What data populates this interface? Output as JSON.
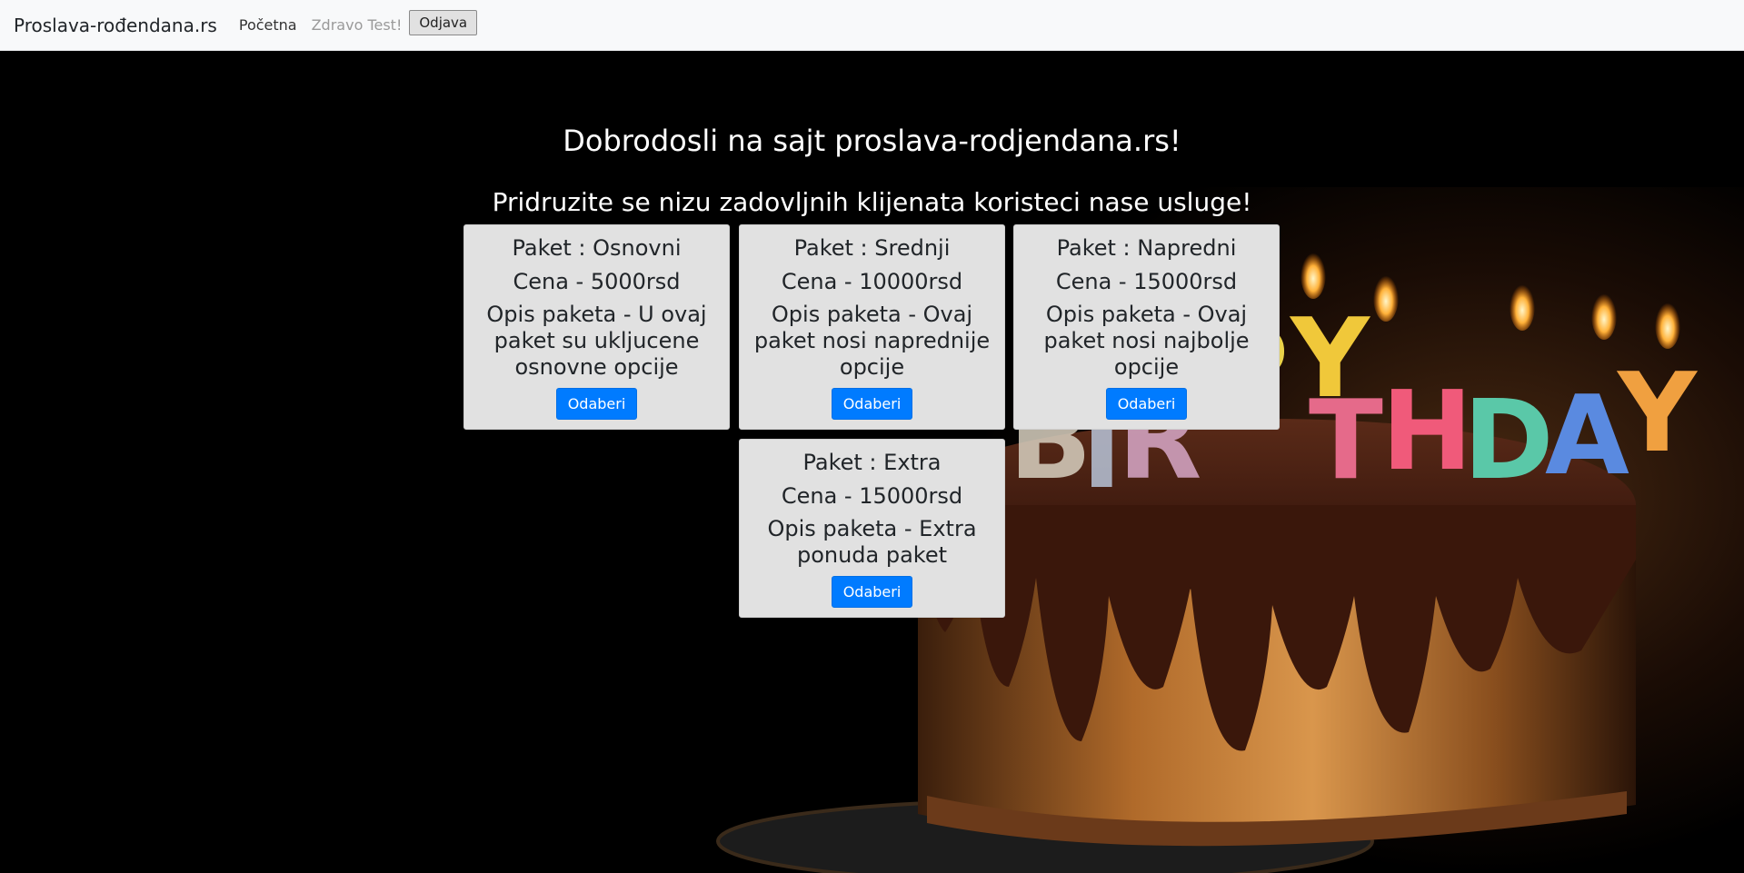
{
  "navbar": {
    "brand": "Proslava-rođendana.rs",
    "home_link": "Početna",
    "greeting": "Zdravo Test!",
    "logout_label": "Odjava"
  },
  "hero": {
    "welcome": "Dobrodosli na sajt proslava-rodjendana.rs!",
    "tagline": "Pridruzite se nizu zadovljnih klijenata koristeci nase usluge!",
    "background_image": "birthday-cake-with-candles",
    "cake_text": "BIRTHDAY"
  },
  "packages": [
    {
      "title": "Paket : Osnovni",
      "price": "Cena - 5000rsd",
      "description": "Opis paketa - U ovaj paket su uklјucene osnovne opcije",
      "button_label": "Odaberi"
    },
    {
      "title": "Paket : Srednji",
      "price": "Cena - 10000rsd",
      "description": "Opis paketa - Ovaj paket nosi naprednije opcije",
      "button_label": "Odaberi"
    },
    {
      "title": "Paket : Napredni",
      "price": "Cena - 15000rsd",
      "description": "Opis paketa - Ovaj paket nosi najbolje opcije",
      "button_label": "Odaberi"
    },
    {
      "title": "Paket : Extra",
      "price": "Cena - 15000rsd",
      "description": "Opis paketa - Extra ponuda paket",
      "button_label": "Odaberi"
    }
  ],
  "colors": {
    "navbar_bg": "#f8f9fa",
    "card_bg": "#e1e1e1",
    "button_primary": "#007bff",
    "hero_text": "#ffffff"
  }
}
